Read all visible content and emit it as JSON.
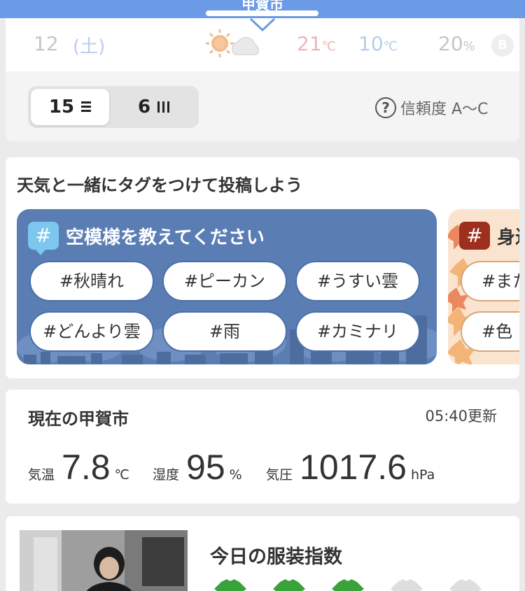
{
  "header": {
    "city": "甲賀市"
  },
  "forecast_row": {
    "day": "12",
    "weekday": "(土)",
    "weather_icon": "sunny-then-cloudy-icon",
    "high": "21",
    "low": "10",
    "temp_unit": "℃",
    "pop": "20",
    "pop_unit": "%",
    "badge": "B"
  },
  "period_toggle": {
    "options": [
      {
        "label": "15",
        "icon": "list-lines-icon",
        "active": true
      },
      {
        "label": "6",
        "icon": "bars-icon",
        "active": false
      }
    ]
  },
  "reliability": {
    "label": "信頼度 A〜C",
    "icon": "question-circle-icon"
  },
  "tags_section": {
    "title": "天気と一緒にタグをつけて投稿しよう",
    "sky_panel": {
      "badge": "#",
      "title": "空模様を教えてください",
      "tags": [
        "#秋晴れ",
        "#ピーカン",
        "#うすい雲",
        "#どんより雲",
        "#雨",
        "#カミナリ"
      ]
    },
    "autumn_panel": {
      "badge": "#",
      "title": "身近",
      "tags": [
        "#また",
        "#色"
      ]
    }
  },
  "current": {
    "title": "現在の甲賀市",
    "updated": "05:40更新",
    "temperature": {
      "label": "気温",
      "value": "7.8",
      "unit": "℃"
    },
    "humidity": {
      "label": "湿度",
      "value": "95",
      "unit": "%"
    },
    "pressure": {
      "label": "気圧",
      "value": "1017.6",
      "unit": "hPa"
    }
  },
  "clothing": {
    "title": "今日の服装指数",
    "level": 3,
    "max": 5,
    "colors": {
      "on": "#3aa23a",
      "off": "#dedede"
    }
  },
  "colors": {
    "header_blue": "#6b9ae6",
    "sky_panel": "#5a7eb4",
    "high_temp": "#efb5b5",
    "low_temp": "#b6cde9"
  }
}
